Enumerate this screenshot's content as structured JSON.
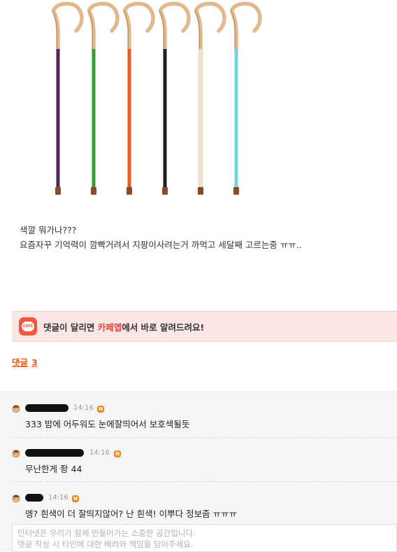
{
  "post": {
    "image_alt": "walking canes in six colors",
    "cane_colors": [
      "#4a2a4e",
      "#2ea02e",
      "#ee5a24",
      "#1e1e1e",
      "#efe6cc",
      "#74d3de"
    ],
    "handle_color": "#e0b98e",
    "tip_color": "#8a4b2c",
    "lines": [
      "색깔 뭐가나???",
      "요즘자꾸 기억력이 깜빡거려서 지팡이사려는거 까먹고 세달째 고르는중 ㅠㅠ.."
    ]
  },
  "banner": {
    "icon": "cafe-app-icon",
    "icon_text": "CAFE",
    "text_before": "댓글이 달리면 ",
    "text_highlight": "카페앱",
    "text_after": "에서 바로 알려드려요!"
  },
  "comment_header": {
    "label": "댓글",
    "count": "3"
  },
  "comments": [
    {
      "time": "14:16",
      "badge": "N",
      "text": "333 밤에 어두워도 눈에잘띄어서 보호색될듯"
    },
    {
      "time": "14:16",
      "badge": "N",
      "text": "무난한게 좡 44"
    },
    {
      "time": "14:16",
      "badge": "N",
      "text": "엥? 흰색이 더 잘띄지않어? 난 흰색! 이뿌다 정보좀 ㅠㅠㅠ"
    }
  ],
  "composer": {
    "placeholder_line1": "인터넷은 우리가 함께 만들어가는 소중한 공간입니다.",
    "placeholder_line2": "댓글 작성 시 타인에 대한 배려와 책임을 담아주세요."
  },
  "colors": {
    "accent": "#e85d1a",
    "banner_bg": "#fbe6e6",
    "badge": "#f08a24"
  }
}
